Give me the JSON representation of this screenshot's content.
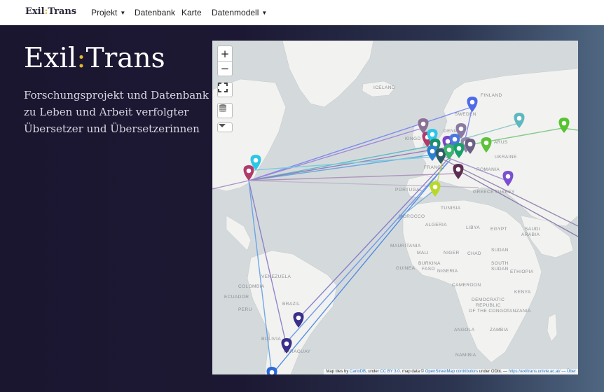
{
  "navbar": {
    "brand_a": "Exil",
    "brand_colon": ":",
    "brand_b": "Trans",
    "items": [
      {
        "label": "Projekt",
        "dropdown": true
      },
      {
        "label": "Datenbank",
        "dropdown": false
      },
      {
        "label": "Karte",
        "dropdown": false
      },
      {
        "label": "Datenmodell",
        "dropdown": true
      }
    ]
  },
  "hero": {
    "title_a": "Exil",
    "title_colon": ":",
    "title_b": "Trans",
    "subtitle_lines": [
      "Forschungsprojekt und Datenbank",
      "zu Leben und Arbeit verfolgter",
      "Übersetzer und Übersetzerinnen"
    ]
  },
  "map": {
    "controls": {
      "zoom_in": "+",
      "zoom_out": "−"
    },
    "labels": {
      "iceland": "ICELAND",
      "finland": "FINLAND",
      "sweden": "SWEDEN",
      "denmark": "DENM",
      "kingdom": "KINGD",
      "belarus": "ARUS",
      "ukraine": "UKRAINE",
      "france": "FRANCE",
      "romania": "ROMANIA",
      "portugal": "PORTUGAL",
      "greece": "GREECE",
      "turkey": "TURKEY",
      "tunisia": "TUNISIA",
      "morocco": "MOROCCO",
      "algeria": "ALGERIA",
      "libya": "LIBYA",
      "egypt": "EGYPT",
      "saudi": "SAUDI",
      "arabia": "ARABIA",
      "mauritania": "MAURITANIA",
      "mali": "MALI",
      "niger": "NIGER",
      "chad": "CHAD",
      "sudan": "SUDAN",
      "south": "SOUTH",
      "sudan2": "SUDAN",
      "ethiopia": "ETHIOPIA",
      "burkina": "BURKINA",
      "faso": "FASO",
      "guinea": "GUINEA",
      "nigeria": "NIGERIA",
      "cameroon": "CAMEROON",
      "kenya": "KENYA",
      "dem_rep": "DEMOCRATIC",
      "republic": "REPUBLIC",
      "of_the_congo": "OF THE CONGO",
      "tanzania": "TANZANIA",
      "angola": "ANGOLA",
      "namibia": "NAMIBIA",
      "zambia": "ZAMBIA",
      "venezuela": "VENEZUELA",
      "colombia": "COLOMBIA",
      "peru": "PERU",
      "brazil": "BRAZIL",
      "bolivia": "BOLIVIA",
      "paraguay": "PARAGUAY",
      "ecuador": "ECUADOR"
    },
    "attribution": {
      "prefix": "Map tiles by ",
      "carto": "CartoDB",
      "under": ", under ",
      "ccby": "CC BY 3.0",
      "mapdata": ". map data © ",
      "osm": "OpenStreetMap contributors",
      "odbl": " under ODbL — ",
      "url": "https://exiltrans.univie.ac.at/",
      "tail": " — Über"
    }
  },
  "colors": {
    "accent": "#e5b92a",
    "water": "#d4dadc",
    "land": "#f2f2f0"
  }
}
